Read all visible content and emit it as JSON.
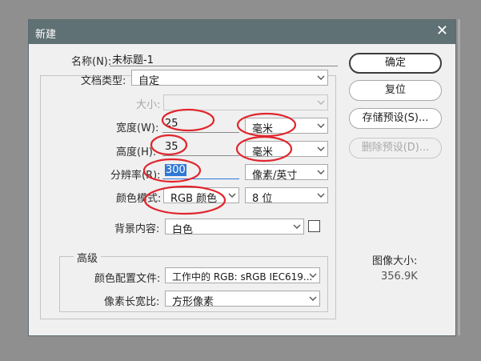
{
  "window": {
    "title": "新建",
    "close_glyph": "✕"
  },
  "form": {
    "name": {
      "label": "名称(N):",
      "value": "未标题-1"
    },
    "preset": {
      "label": "文档类型:",
      "value": "自定"
    },
    "size": {
      "label": "大小:",
      "value": ""
    },
    "width": {
      "label": "宽度(W):",
      "value": "25",
      "unit": "毫米"
    },
    "height": {
      "label": "高度(H):",
      "value": "35",
      "unit": "毫米"
    },
    "resolution": {
      "label": "分辨率(R):",
      "value": "300",
      "unit": "像素/英寸"
    },
    "color_mode": {
      "label": "颜色模式:",
      "value": "RGB 颜色",
      "depth": "8 位"
    },
    "background": {
      "label": "背景内容:",
      "value": "白色"
    },
    "advanced": {
      "title": "高级",
      "profile": {
        "label": "颜色配置文件:",
        "value": "工作中的 RGB: sRGB IEC619..."
      },
      "pixel_aspect": {
        "label": "像素长宽比:",
        "value": "方形像素"
      }
    }
  },
  "buttons": {
    "ok": "确定",
    "reset": "复位",
    "save_preset": "存储预设(S)...",
    "delete_preset": "删除预设(D)..."
  },
  "image_size": {
    "label": "图像大小:",
    "value": "356.9K"
  },
  "colors": {
    "titlebar": "#5f7174",
    "annotation": "#e0262d",
    "selection": "#2f78d6"
  }
}
